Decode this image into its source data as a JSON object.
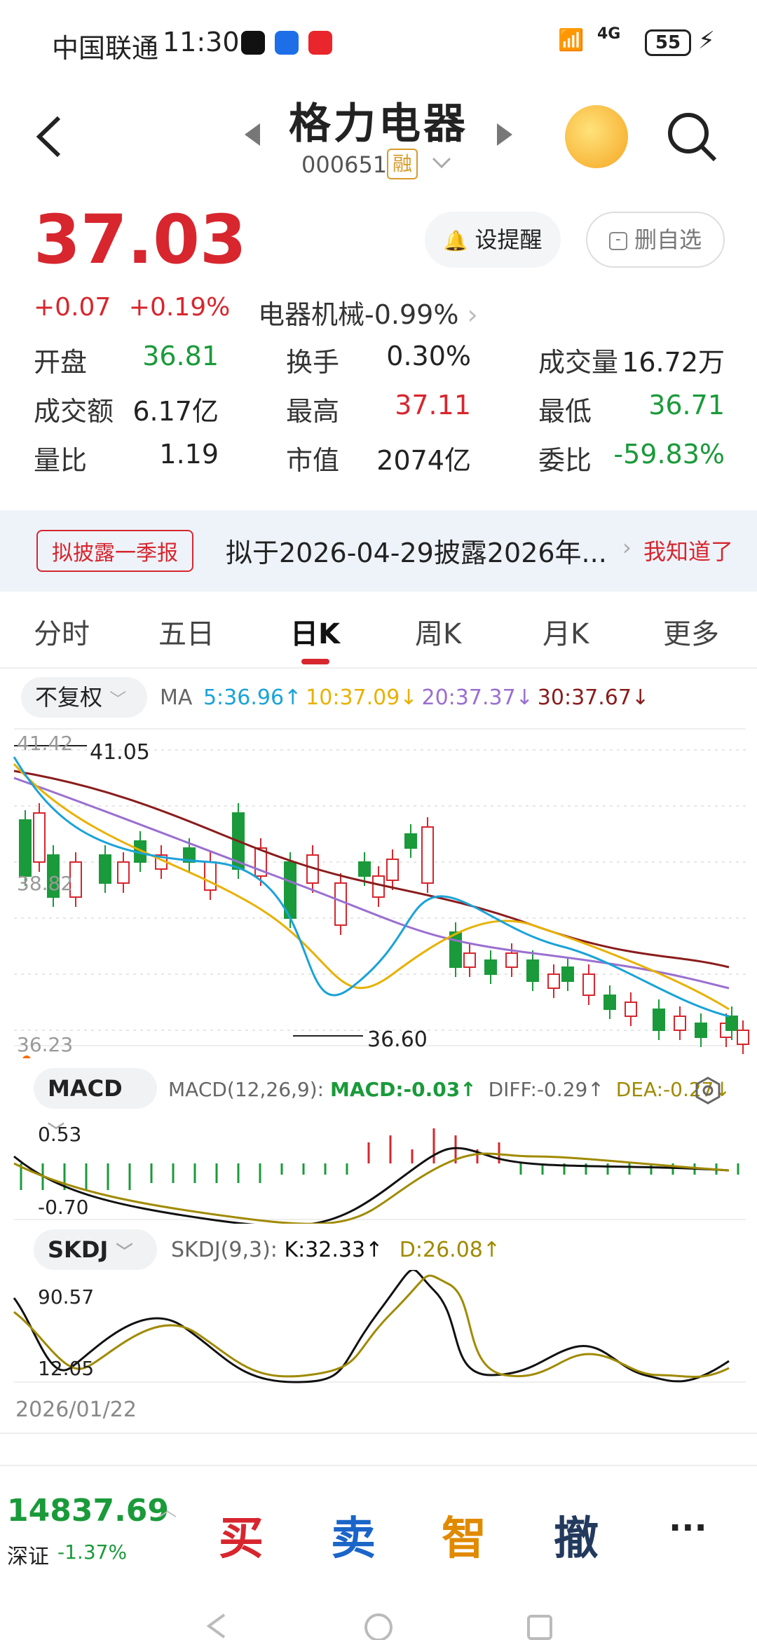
{
  "status": {
    "carrier": "中国联通",
    "time": "11:30",
    "battery": "55",
    "net": "4G"
  },
  "header": {
    "title": "格力电器",
    "code": "000651",
    "tag": "融"
  },
  "quote": {
    "price": "37.03",
    "change": "+0.07",
    "change_pct": "+0.19%",
    "sector": "电器机械",
    "sector_pct": "-0.99%",
    "remind_label": "设提醒",
    "remove_label": "删自选",
    "rows": [
      [
        {
          "label": "开盘",
          "value": "36.81",
          "color": "green"
        },
        {
          "label": "换手",
          "value": "0.30%",
          "color": "black"
        },
        {
          "label": "成交量",
          "value": "16.72万",
          "color": "black"
        }
      ],
      [
        {
          "label": "成交额",
          "value": "6.17亿",
          "color": "black"
        },
        {
          "label": "最高",
          "value": "37.11",
          "color": "red"
        },
        {
          "label": "最低",
          "value": "36.71",
          "color": "green"
        }
      ],
      [
        {
          "label": "量比",
          "value": "1.19",
          "color": "black"
        },
        {
          "label": "市值",
          "value": "2074亿",
          "color": "black"
        },
        {
          "label": "委比",
          "value": "-59.83%",
          "color": "green"
        }
      ]
    ]
  },
  "notice": {
    "badge": "拟披露一季报",
    "text": "拟于2026-04-29披露2026年...",
    "action": "我知道了"
  },
  "tabs": [
    "分时",
    "五日",
    "日K",
    "周K",
    "月K",
    "更多"
  ],
  "active_tab": "日K",
  "kline": {
    "adjust": "不复权",
    "ma_label": "MA",
    "ma": [
      {
        "label": "5:36.96",
        "arrow": "↑",
        "color": "#1aa3d8"
      },
      {
        "label": "10:37.09",
        "arrow": "↓",
        "color": "#e8b100"
      },
      {
        "label": "20:37.37",
        "arrow": "↓",
        "color": "#9a6fd0"
      },
      {
        "label": "30:37.67",
        "arrow": "↓",
        "color": "#8a1c1c"
      }
    ],
    "axis_top": "41.42",
    "axis_mid": "38.82",
    "axis_bottom": "36.23",
    "high_mark": "41.05",
    "low_mark": "36.60"
  },
  "macd": {
    "chip": "MACD",
    "params": "MACD(12,26,9):",
    "macd": "MACD:-0.03↑",
    "diff": "DIFF:-0.29↑",
    "dea": "DEA:-0.27↓",
    "axis_top": "0.53",
    "axis_bottom": "-0.70"
  },
  "kdj": {
    "chip": "SKDJ",
    "params": "SKDJ(9,3):",
    "k": "K:32.33↑",
    "d": "D:26.08↑",
    "axis_top": "90.57",
    "axis_bottom": "12.05",
    "date": "2026/01/22"
  },
  "bottom": {
    "index_value": "14837.69",
    "index_name": "深证",
    "index_pct": "-1.37%",
    "buy": "买",
    "sell": "卖",
    "smart": "智",
    "cancel": "撤",
    "more": "···"
  },
  "colors": {
    "up": "#d7262e",
    "down": "#1a9a3a",
    "accent": "#d7262e"
  }
}
